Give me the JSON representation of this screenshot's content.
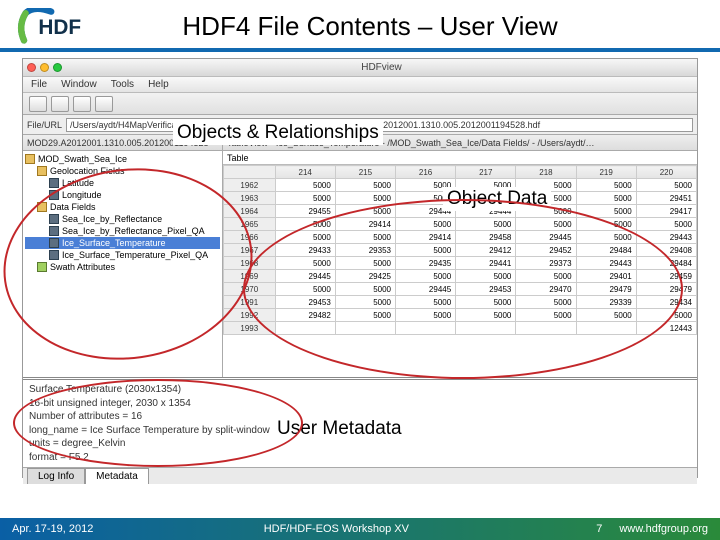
{
  "slide": {
    "title": "HDF4 File Contents – User View"
  },
  "annotations": {
    "objects_relationships": "Objects & Relationships",
    "object_data": "Object Data",
    "user_metadata": "User Metadata"
  },
  "app": {
    "window_title": "HDFview",
    "menu": {
      "file": "File",
      "window": "Window",
      "tools": "Tools",
      "help": "Help"
    },
    "url_label": "File/URL",
    "url_value": "/Users/aydt/H4MapVerification/SampleFiles/NSIDC/MODIS_TERRA/MOD29.A2012001.1310.005.2012001194528.hdf",
    "tree_tab": "MOD29.A2012001.1310.005.2012001194528",
    "tree": {
      "root": "MOD_Swath_Sea_Ice",
      "group_geo": "Geolocation Fields",
      "lat": "Latitude",
      "lon": "Longitude",
      "group_data": "Data Fields",
      "d1": "Sea_Ice_by_Reflectance",
      "d2": "Sea_Ice_by_Reflectance_Pixel_QA",
      "d3": "Ice_Surface_Temperature",
      "d4": "Ice_Surface_Temperature_Pixel_QA",
      "swath_attr": "Swath Attributes"
    },
    "table": {
      "title": "TableView  -  Ice_Surface_Temperature  -  /MOD_Swath_Sea_Ice/Data Fields/  -  /Users/aydt/…",
      "menu_table": "Table",
      "col_headers": [
        "214",
        "215",
        "216",
        "217",
        "218",
        "219",
        "220"
      ],
      "row_headers": [
        "1962",
        "1963",
        "1964",
        "1965",
        "1966",
        "1967",
        "1968",
        "1969",
        "1970",
        "1991",
        "1992",
        "1993"
      ],
      "rows": [
        [
          "5000",
          "5000",
          "5000",
          "5000",
          "5000",
          "5000",
          "5000"
        ],
        [
          "5000",
          "5000",
          "5000",
          "5000",
          "5000",
          "5000",
          "29451"
        ],
        [
          "29455",
          "5000",
          "29444",
          "29444",
          "5000",
          "5000",
          "29417"
        ],
        [
          "5000",
          "29414",
          "5000",
          "5000",
          "5000",
          "5000",
          "5000"
        ],
        [
          "5000",
          "5000",
          "29414",
          "29458",
          "29445",
          "5000",
          "29443"
        ],
        [
          "29433",
          "29353",
          "5000",
          "29412",
          "29452",
          "29484",
          "29408"
        ],
        [
          "5000",
          "5000",
          "29435",
          "29441",
          "29373",
          "29443",
          "29484"
        ],
        [
          "29445",
          "29425",
          "5000",
          "5000",
          "5000",
          "29401",
          "29459"
        ],
        [
          "5000",
          "5000",
          "29445",
          "29453",
          "29470",
          "29479",
          "29479"
        ],
        [
          "29453",
          "5000",
          "5000",
          "5000",
          "5000",
          "29339",
          "29434"
        ],
        [
          "29482",
          "5000",
          "5000",
          "5000",
          "5000",
          "5000",
          "5000"
        ],
        [
          "",
          "",
          "",
          "",
          "",
          "",
          "12443"
        ]
      ]
    },
    "metadata": {
      "line1": "Surface Temperature (2030x1354)",
      "line2": "16-bit unsigned integer,   2030 x 1354",
      "line3": "Number of attributes = 16",
      "line4": "    long_name = Ice Surface Temperature by split-window method",
      "line5": "    units = degree_Kelvin",
      "line6": "    format = F5.2",
      "tab_log": "Log Info",
      "tab_meta": "Metadata"
    }
  },
  "footer": {
    "date": "Apr. 17-19, 2012",
    "center": "HDF/HDF-EOS Workshop XV",
    "page": "7",
    "url": "www.hdfgroup.org"
  }
}
